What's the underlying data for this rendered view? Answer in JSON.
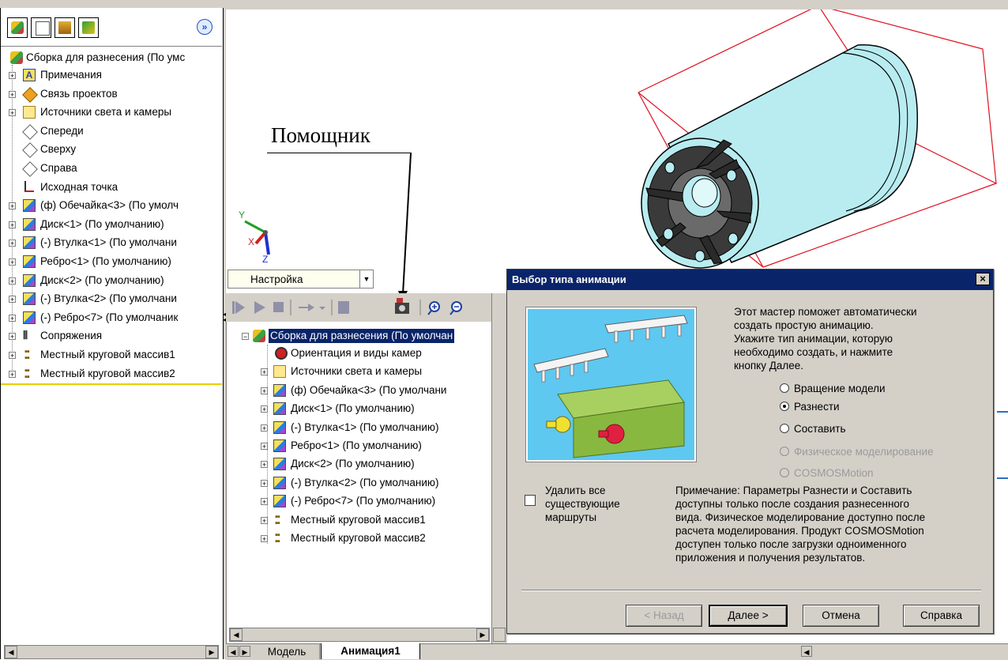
{
  "feature_tree": {
    "root": "Сборка для разнесения  (По умс",
    "items": [
      {
        "label": "Примечания",
        "icon": "annotations-icon"
      },
      {
        "label": "Связь проектов",
        "icon": "design-binder-icon"
      },
      {
        "label": "Источники света и камеры",
        "icon": "lights-icon"
      },
      {
        "label": "Спереди",
        "icon": "plane-icon"
      },
      {
        "label": "Сверху",
        "icon": "plane-icon"
      },
      {
        "label": "Справа",
        "icon": "plane-icon"
      },
      {
        "label": "Исходная точка",
        "icon": "origin-icon"
      },
      {
        "label": "(ф) Обечайка<3> (По умолч",
        "icon": "part-icon"
      },
      {
        "label": "Диск<1> (По умолчанию)",
        "icon": "part-icon"
      },
      {
        "label": "(-) Втулка<1> (По умолчани",
        "icon": "part-icon"
      },
      {
        "label": "Ребро<1> (По умолчанию)",
        "icon": "part-icon"
      },
      {
        "label": "Диск<2> (По умолчанию)",
        "icon": "part-icon"
      },
      {
        "label": "(-) Втулка<2> (По умолчани",
        "icon": "part-icon"
      },
      {
        "label": "(-) Ребро<7> (По умолчаник",
        "icon": "part-icon"
      },
      {
        "label": "Сопряжения",
        "icon": "mates-icon"
      },
      {
        "label": "Местный круговой массив1",
        "icon": "pattern-icon"
      },
      {
        "label": "Местный круговой массив2",
        "icon": "pattern-icon"
      }
    ]
  },
  "annotation_label": "Помощник",
  "axes": {
    "x": "X",
    "y": "Y",
    "z": "Z"
  },
  "config_select": "Настройка",
  "animation_tree": {
    "root": "Сборка для разнесения  (По умолчан",
    "items": [
      "Ориентация и виды камер",
      "Источники света и камеры",
      "(ф) Обечайка<3> (По умолчани",
      "Диск<1> (По умолчанию)",
      "(-) Втулка<1> (По умолчанию)",
      "Ребро<1> (По умолчанию)",
      "Диск<2> (По умолчанию)",
      "(-) Втулка<2> (По умолчанию)",
      "(-) Ребро<7> (По умолчанию)",
      "Местный круговой массив1",
      "Местный круговой массив2"
    ]
  },
  "tabs": [
    "Модель",
    "Анимация1"
  ],
  "dialog": {
    "title": "Выбор типа анимации",
    "close": "×",
    "intro": [
      "Этот мастер поможет автоматически",
      "создать простую анимацию.",
      "Укажите тип анимации, которую",
      "необходимо создать, и нажмите",
      "кнопку Далее."
    ],
    "options": [
      {
        "label": "Вращение модели",
        "checked": false,
        "disabled": false
      },
      {
        "label": "Разнести",
        "checked": true,
        "disabled": false
      },
      {
        "label": "Составить",
        "checked": false,
        "disabled": false
      },
      {
        "label": "Физическое моделирование",
        "checked": false,
        "disabled": true
      },
      {
        "label": "COSMOSMotion",
        "checked": false,
        "disabled": true
      }
    ],
    "delete_paths": [
      "Удалить все",
      "существующие",
      "маршруты"
    ],
    "note": [
      "Примечание: Параметры Разнести и Составить",
      "доступны только после создания разнесенного",
      "вида. Физическое моделирование доступно после",
      "расчета моделирования. Продукт COSMOSMotion",
      "доступен только после загрузки одноименного",
      "приложения и получения результатов."
    ],
    "buttons": {
      "back": "< Назад",
      "next": "Далее >",
      "cancel": "Отмена",
      "help": "Справка"
    }
  },
  "colors": {
    "title_bar": "#0a246a",
    "selection": "#0a246a",
    "bbox_red": "#e01020",
    "cylinder": "#b8ecf0"
  }
}
